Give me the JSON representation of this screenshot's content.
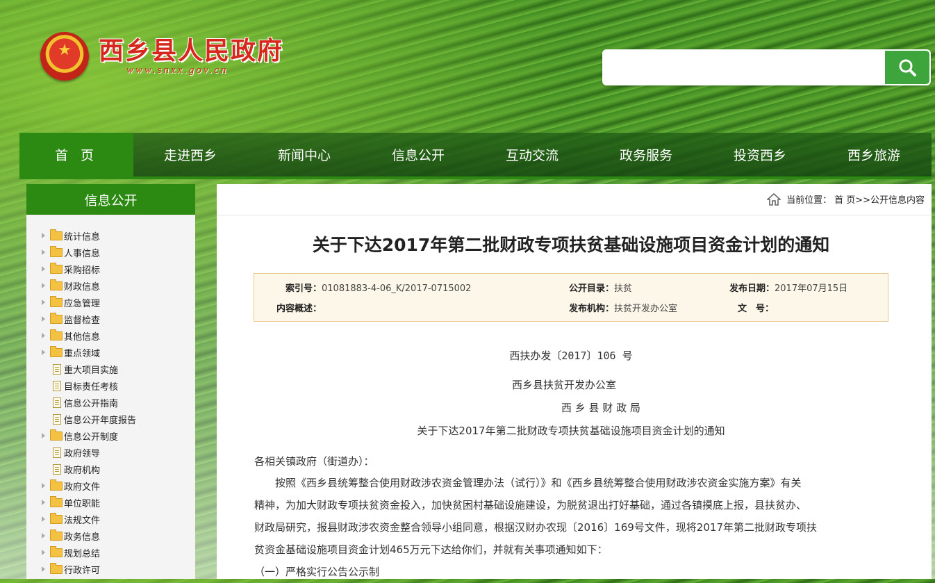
{
  "header": {
    "site_title": "西乡县人民政府",
    "site_url": "www.snxx.gov.cn",
    "search_placeholder": ""
  },
  "nav": {
    "items": [
      "首 页",
      "走进西乡",
      "新闻中心",
      "信息公开",
      "互动交流",
      "政务服务",
      "投资西乡",
      "西乡旅游"
    ],
    "active_index": 0
  },
  "sidebar": {
    "title": "信息公开",
    "items": [
      {
        "label": "统计信息",
        "icon": "folder-icon"
      },
      {
        "label": "人事信息",
        "icon": "folder-icon"
      },
      {
        "label": "采购招标",
        "icon": "folder-icon"
      },
      {
        "label": "财政信息",
        "icon": "folder-icon"
      },
      {
        "label": "应急管理",
        "icon": "folder-icon"
      },
      {
        "label": "监督检查",
        "icon": "folder-icon"
      },
      {
        "label": "其他信息",
        "icon": "folder-icon"
      },
      {
        "label": "重点领域",
        "icon": "folder-icon"
      },
      {
        "label": "重大项目实施",
        "icon": "doc-icon"
      },
      {
        "label": "目标责任考核",
        "icon": "doc-icon"
      },
      {
        "label": "信息公开指南",
        "icon": "doc-icon"
      },
      {
        "label": "信息公开年度报告",
        "icon": "doc-icon"
      },
      {
        "label": "信息公开制度",
        "icon": "folder-icon"
      },
      {
        "label": "政府领导",
        "icon": "doc-icon"
      },
      {
        "label": "政府机构",
        "icon": "doc-icon"
      },
      {
        "label": "政府文件",
        "icon": "folder-icon"
      },
      {
        "label": "单位职能",
        "icon": "folder-icon"
      },
      {
        "label": "法规文件",
        "icon": "folder-icon"
      },
      {
        "label": "政务信息",
        "icon": "folder-icon"
      },
      {
        "label": "规划总结",
        "icon": "folder-icon"
      },
      {
        "label": "行政许可",
        "icon": "folder-icon"
      }
    ]
  },
  "breadcrumb": {
    "prefix": "当前位置：",
    "path": "首 页>>公开信息内容"
  },
  "article": {
    "title": "关于下达2017年第二批财政专项扶贫基础设施项目资金计划的通知",
    "meta": {
      "index_label": "索引号：",
      "index_value": "01081883-4-06_K/2017-0715002",
      "catalog_label": "公开目录：",
      "catalog_value": "扶贫",
      "date_label": "发布日期：",
      "date_value": "2017年07月15日",
      "summary_label": "内容概述：",
      "summary_value": "",
      "org_label": "发布机构：",
      "org_value": "扶贫开发办公室",
      "docno_label": "文　号：",
      "docno_value": ""
    },
    "doc_number": "西扶办发〔2017〕106 号",
    "issuer1": "西乡县扶贫开发办公室",
    "issuer2": "西 乡 县 财 政 局",
    "subtitle": "关于下达2017年第二批财政专项扶贫基础设施项目资金计划的通知",
    "salutation": "各相关镇政府（街道办）：",
    "body_lines": [
      "　　按照《西乡县统筹整合使用财政涉农资金管理办法（试行）》和《西乡县统筹整合使用财政涉农资金实施方案》有关",
      "精神，为加大财政专项扶贫资金投入，加快贫困村基础设施建设，为脱贫退出打好基础，通过各镇摸底上报，县扶贫办、",
      "财政局研究，报县财政涉农资金整合领导小组同意，根据汉财办农现〔2016〕169号文件，现将2017年第二批财政专项扶",
      "贫资金基础设施项目资金计划465万元下达给你们，并就有关事项通知如下："
    ],
    "section1": "（一）严格实行公告公示制"
  },
  "colors": {
    "nav_active": "#2c8a13",
    "title_red": "#d7261b",
    "search_green": "#3ea43c"
  }
}
